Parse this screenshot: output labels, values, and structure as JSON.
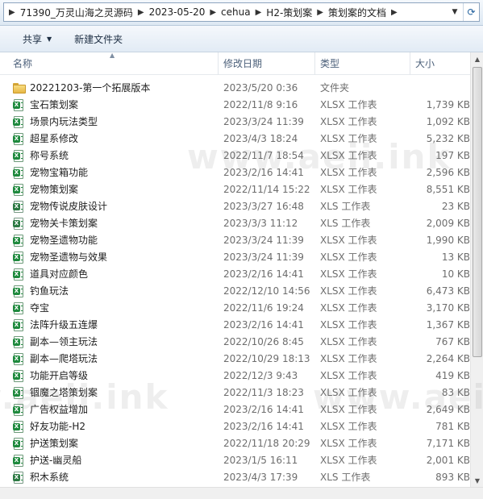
{
  "address": {
    "crumbs": [
      "71390_万灵山海之灵源码",
      "2023-05-20",
      "cehua",
      "H2-策划案",
      "策划案的文档"
    ]
  },
  "toolbar": {
    "share_label": "共享",
    "new_folder_label": "新建文件夹"
  },
  "columns": {
    "name": "名称",
    "date": "修改日期",
    "type": "类型",
    "size": "大小"
  },
  "watermark": "www.aeii.ink",
  "files": [
    {
      "name": "20221203-第一个拓展版本",
      "date": "2023/5/20 0:36",
      "type": "文件夹",
      "size": "",
      "icon": "folder-icon"
    },
    {
      "name": "宝石策划案",
      "date": "2022/11/8 9:16",
      "type": "XLSX 工作表",
      "size": "1,739 KB",
      "icon": "xlsx-file-icon"
    },
    {
      "name": "场景内玩法类型",
      "date": "2023/3/24 11:39",
      "type": "XLSX 工作表",
      "size": "1,092 KB",
      "icon": "xlsx-file-icon"
    },
    {
      "name": "超星系修改",
      "date": "2023/4/3 18:24",
      "type": "XLSX 工作表",
      "size": "5,232 KB",
      "icon": "xlsx-file-icon"
    },
    {
      "name": "称号系统",
      "date": "2022/11/7 18:54",
      "type": "XLSX 工作表",
      "size": "197 KB",
      "icon": "xlsx-file-icon"
    },
    {
      "name": "宠物宝箱功能",
      "date": "2023/2/16 14:41",
      "type": "XLSX 工作表",
      "size": "2,596 KB",
      "icon": "xlsx-file-icon"
    },
    {
      "name": "宠物策划案",
      "date": "2022/11/14 15:22",
      "type": "XLSX 工作表",
      "size": "8,551 KB",
      "icon": "xlsx-file-icon"
    },
    {
      "name": "宠物传说皮肤设计",
      "date": "2023/3/27 16:48",
      "type": "XLS 工作表",
      "size": "23 KB",
      "icon": "xls-file-icon"
    },
    {
      "name": "宠物关卡策划案",
      "date": "2023/3/3 11:12",
      "type": "XLS 工作表",
      "size": "2,009 KB",
      "icon": "xls-file-icon"
    },
    {
      "name": "宠物圣遗物功能",
      "date": "2023/3/24 11:39",
      "type": "XLSX 工作表",
      "size": "1,990 KB",
      "icon": "xlsx-file-icon"
    },
    {
      "name": "宠物圣遗物与效果",
      "date": "2023/3/24 11:39",
      "type": "XLSX 工作表",
      "size": "13 KB",
      "icon": "xlsx-file-icon"
    },
    {
      "name": "道具对应颜色",
      "date": "2023/2/16 14:41",
      "type": "XLSX 工作表",
      "size": "10 KB",
      "icon": "xlsx-file-icon"
    },
    {
      "name": "钓鱼玩法",
      "date": "2022/12/10 14:56",
      "type": "XLSX 工作表",
      "size": "6,473 KB",
      "icon": "xlsx-file-icon"
    },
    {
      "name": "夺宝",
      "date": "2022/11/6 19:24",
      "type": "XLSX 工作表",
      "size": "3,170 KB",
      "icon": "xlsx-file-icon"
    },
    {
      "name": "法阵升级五连爆",
      "date": "2023/2/16 14:41",
      "type": "XLSX 工作表",
      "size": "1,367 KB",
      "icon": "xlsx-file-icon"
    },
    {
      "name": "副本—领主玩法",
      "date": "2022/10/26 8:45",
      "type": "XLSX 工作表",
      "size": "767 KB",
      "icon": "xlsx-file-icon"
    },
    {
      "name": "副本—爬塔玩法",
      "date": "2022/10/29 18:13",
      "type": "XLSX 工作表",
      "size": "2,264 KB",
      "icon": "xlsx-file-icon"
    },
    {
      "name": "功能开启等级",
      "date": "2022/12/3 9:43",
      "type": "XLSX 工作表",
      "size": "419 KB",
      "icon": "xlsx-file-icon"
    },
    {
      "name": "锢魔之塔策划案",
      "date": "2022/11/3 18:23",
      "type": "XLSX 工作表",
      "size": "83 KB",
      "icon": "xlsx-file-icon"
    },
    {
      "name": "广告权益增加",
      "date": "2023/2/16 14:41",
      "type": "XLSX 工作表",
      "size": "2,649 KB",
      "icon": "xlsx-file-icon"
    },
    {
      "name": "好友功能-H2",
      "date": "2023/2/16 14:41",
      "type": "XLSX 工作表",
      "size": "781 KB",
      "icon": "xlsx-file-icon"
    },
    {
      "name": "护送策划案",
      "date": "2022/11/18 20:29",
      "type": "XLSX 工作表",
      "size": "7,171 KB",
      "icon": "xlsx-file-icon"
    },
    {
      "name": "护送-幽灵船",
      "date": "2023/1/5 16:11",
      "type": "XLSX 工作表",
      "size": "2,001 KB",
      "icon": "xlsx-file-icon"
    },
    {
      "name": "积木系统",
      "date": "2023/4/3 17:39",
      "type": "XLS 工作表",
      "size": "893 KB",
      "icon": "xls-file-icon"
    }
  ]
}
